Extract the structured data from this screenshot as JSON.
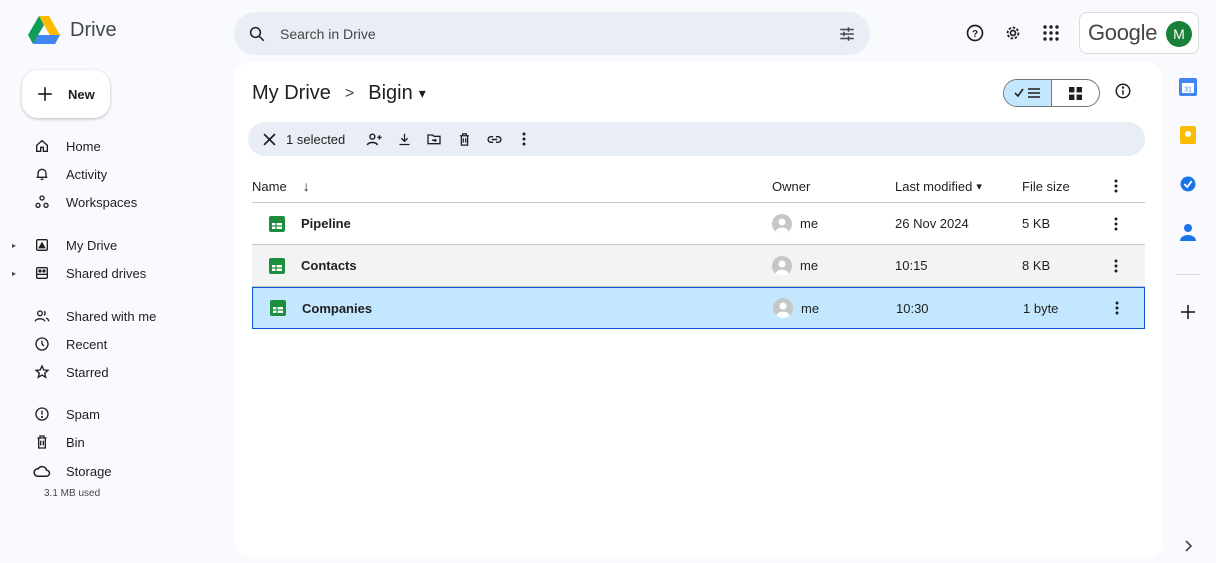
{
  "app": {
    "name": "Drive",
    "google_label": "Google",
    "avatar_letter": "M"
  },
  "search": {
    "placeholder": "Search in Drive"
  },
  "sidebar": {
    "new_label": "New",
    "items": [
      {
        "label": "Home",
        "icon": "home-icon"
      },
      {
        "label": "Activity",
        "icon": "bell-icon"
      },
      {
        "label": "Workspaces",
        "icon": "workspaces-icon"
      },
      {
        "label": "My Drive",
        "icon": "my-drive-icon"
      },
      {
        "label": "Shared drives",
        "icon": "shared-drives-icon"
      },
      {
        "label": "Shared with me",
        "icon": "people-icon"
      },
      {
        "label": "Recent",
        "icon": "clock-icon"
      },
      {
        "label": "Starred",
        "icon": "star-icon"
      },
      {
        "label": "Spam",
        "icon": "spam-icon"
      },
      {
        "label": "Bin",
        "icon": "trash-icon"
      },
      {
        "label": "Storage",
        "icon": "cloud-icon"
      }
    ],
    "storage_used": "3.1 MB used"
  },
  "breadcrumb": {
    "root": "My Drive",
    "separator": ">",
    "current": "Bigin",
    "dropdown": "▾"
  },
  "selection": {
    "count_label": "1 selected"
  },
  "table": {
    "headers": {
      "name": "Name",
      "name_sort": "↓",
      "owner": "Owner",
      "modified": "Last modified",
      "modified_arrow": "▾",
      "size": "File size"
    },
    "rows": [
      {
        "name": "Pipeline",
        "owner": "me",
        "modified": "26 Nov 2024",
        "size": "5 KB",
        "state": "normal"
      },
      {
        "name": "Contacts",
        "owner": "me",
        "modified": "10:15",
        "size": "8 KB",
        "state": "hover"
      },
      {
        "name": "Companies",
        "owner": "me",
        "modified": "10:30",
        "size": "1 byte",
        "state": "selected"
      }
    ]
  },
  "colors": {
    "accent": "#0b57d0",
    "selected_row": "#c2e7ff",
    "sheets_green": "#1e8e3e"
  }
}
